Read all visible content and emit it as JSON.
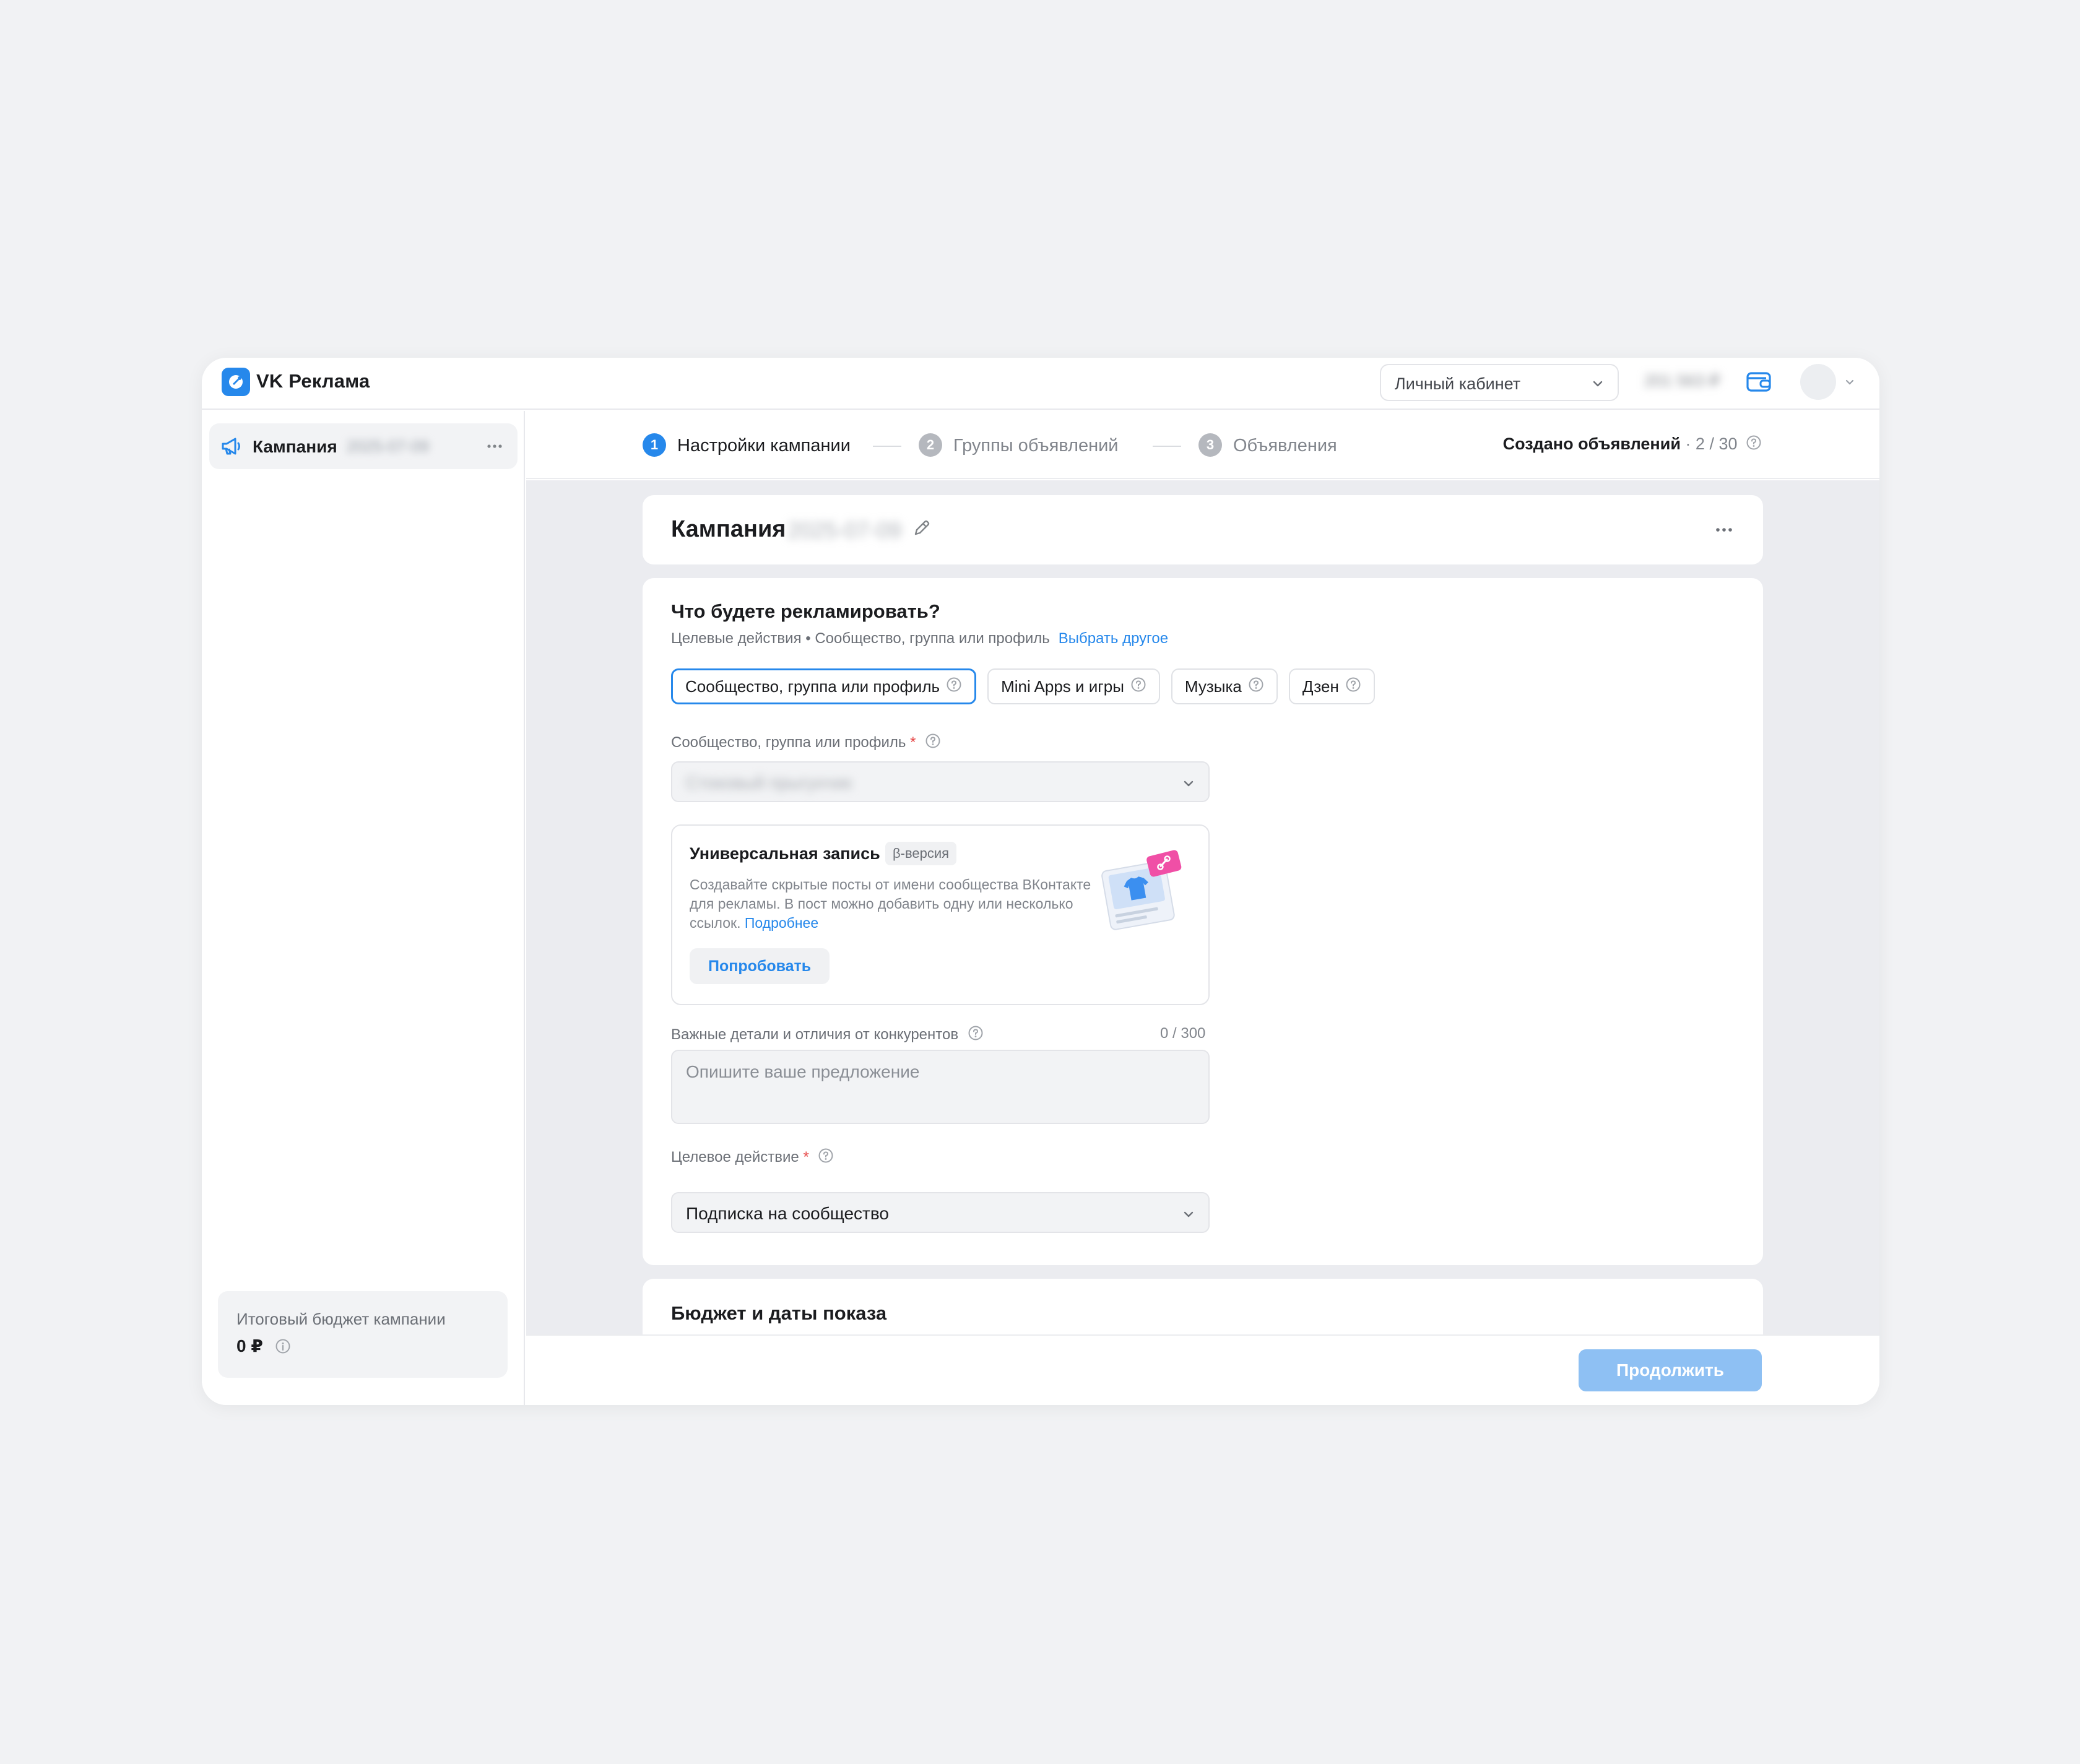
{
  "app": {
    "brand": "VK Реклама"
  },
  "header": {
    "account_select": "Личный кабинет",
    "balance": "201 563 ₽",
    "icons": {
      "wallet": "wallet-icon",
      "chevron": "chevron-down-icon"
    }
  },
  "sidebar": {
    "campaign_label": "Кампания",
    "campaign_date": "2025-07-09",
    "budget_label": "Итоговый бюджет кампании",
    "budget_value": "0 ₽"
  },
  "steps": [
    {
      "num": "1",
      "label": "Настройки кампании",
      "state": "active"
    },
    {
      "num": "2",
      "label": "Группы объявлений",
      "state": "idle"
    },
    {
      "num": "3",
      "label": "Объявления",
      "state": "idle"
    }
  ],
  "ads_created": {
    "label": "Создано объявлений",
    "sep": " · ",
    "count": "2 / 30"
  },
  "campaign_card": {
    "title": "Кампания",
    "date": "2025-07-09"
  },
  "what": {
    "title": "Что будете рекламировать?",
    "subtitle": "Целевые действия • Сообщество, группа или профиль",
    "choose_other": "Выбрать другое",
    "chips": [
      "Сообщество, группа или профиль",
      "Mini Apps и игры",
      "Музыка",
      "Дзен"
    ],
    "selected_chip": 0
  },
  "community_field": {
    "label": "Сообщество, группа или профиль",
    "required_mark": "*",
    "value": "Стоковый прыгунчик"
  },
  "promo": {
    "title": "Универсальная запись",
    "badge": "β-версия",
    "desc": "Создавайте скрытые посты от имени сообщества ВКонтакте для рекламы. В пост можно добавить одну или несколько ссылок.",
    "more_link": "Подробнее",
    "button": "Попробовать"
  },
  "details_field": {
    "label": "Важные детали и отличия от конкурентов",
    "counter": "0 / 300",
    "placeholder": "Опишите ваше предложение"
  },
  "target_action": {
    "label": "Целевое действие",
    "required_mark": "*",
    "value": "Подписка на сообщество"
  },
  "budget_card": {
    "title": "Бюджет и даты показа"
  },
  "footer": {
    "continue": "Продолжить"
  },
  "colors": {
    "accent": "#2688eb",
    "continue_disabled": "#8ec0f3",
    "required": "#e64646"
  }
}
